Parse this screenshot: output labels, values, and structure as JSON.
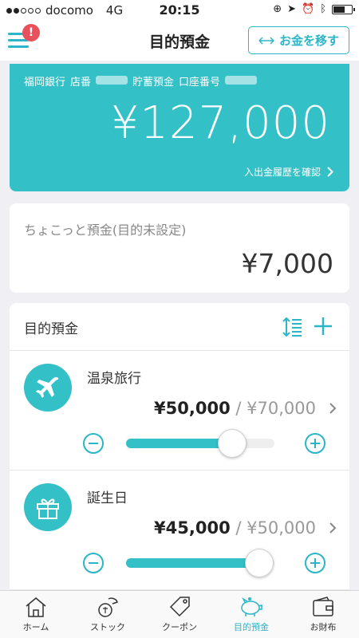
{
  "status_bar": {
    "carrier": "docomo",
    "network": "4G",
    "time": "20:15"
  },
  "nav": {
    "title": "目的預金",
    "menu_badge": "!",
    "transfer_label": "お金を移す"
  },
  "account": {
    "bank": "福岡銀行",
    "branch_label": "店番",
    "account_type": "貯蓄預金",
    "account_number_label": "口座番号",
    "balance": "¥127,000",
    "history_link": "入出金履歴を確認"
  },
  "unassigned": {
    "label": "ちょこっと預金(目的未設定)",
    "amount": "¥7,000"
  },
  "goals": {
    "title": "目的預金",
    "items": [
      {
        "name": "温泉旅行",
        "saved": "¥50,000",
        "separator": "/",
        "target": "¥70,000",
        "progress": 0.714,
        "icon": "airplane-icon"
      },
      {
        "name": "誕生日",
        "saved": "¥45,000",
        "separator": "/",
        "target": "¥50,000",
        "progress": 0.9,
        "icon": "gift-icon"
      }
    ]
  },
  "tabs": [
    {
      "label": "ホーム",
      "icon": "home-icon",
      "active": false
    },
    {
      "label": "ストック",
      "icon": "stock-icon",
      "active": false
    },
    {
      "label": "クーポン",
      "icon": "coupon-icon",
      "active": false
    },
    {
      "label": "目的預金",
      "icon": "piggy-bank-icon",
      "active": true
    },
    {
      "label": "お財布",
      "icon": "wallet-icon",
      "active": false
    }
  ],
  "colors": {
    "accent": "#2ab5c8",
    "card": "#33c0c6",
    "badge": "#e8505b"
  }
}
